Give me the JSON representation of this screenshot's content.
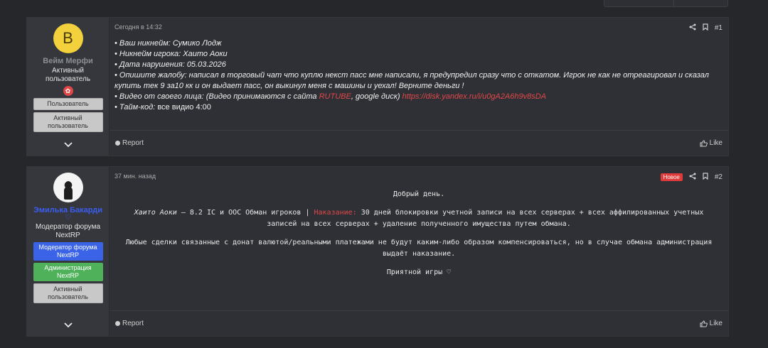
{
  "post1": {
    "user": {
      "avatar_letter": "B",
      "avatar_color": "#f2d13c",
      "name": "Вейм Мерфи",
      "title_line1": "Активный",
      "title_line2": "пользователь",
      "banners": [
        "Пользователь",
        "Активный пользователь"
      ]
    },
    "time": "Сегодня в 14:32",
    "number": "#1",
    "lines": [
      "• Ваш никнейм: Сумико Лодж",
      "• Никнейм игрока: Хаито Аоки",
      "• Дата нарушения: 05.03.2026",
      "• Опишите жалобу: написал в торговый чат что куплю некст пасс мне написали, я предупредил сразу что с откатом. Игрок не как не отреагировал и сказал купить тек 9 за10 кк и он выдает пасс, он выкинул меня с машины и уехал! Верните деньги !"
    ],
    "video_label": "• Видео от своего лица: (Видео принимаются с сайта ",
    "video_rutube": "RUTUBE",
    "video_rest": ", google диск) ",
    "video_link": "https://disk.yandex.ru/i/u0gA2A6h9v8sDA",
    "timecode_label": "• Тайм-код: ",
    "timecode_value": "все видио 4:00",
    "report": "Report",
    "like": "Like"
  },
  "post2": {
    "user": {
      "name": "Эмилька Бакарди",
      "heart": "♡",
      "title_line1": "Модератор форума",
      "title_line2": "NextRP",
      "banners": [
        "Модератор форума NextRP",
        "Администрация NextRP",
        "Активный пользователь"
      ]
    },
    "time": "37 мин. назад",
    "new_badge": "Новое",
    "number": "#2",
    "greeting": "Добрый день.",
    "verdict_name": "Хаито Аоки",
    "verdict_rule": " – 8.2 IC и OOC Обман игроков | ",
    "verdict_label": "Наказание:",
    "verdict_text": " 30 дней блокировки учетной записи на всех серверах + всех аффилированных учетных записей на всех серверах + удаление полученного имущества путем обмана.",
    "notice": "Любые сделки связанные с донат валютой/реальными платежами не будут каким-либо образом компенсироваться, но в случае обмана администрация выдаёт наказание.",
    "closing": "Приятной игры ♡",
    "report": "Report",
    "like": "Like"
  }
}
